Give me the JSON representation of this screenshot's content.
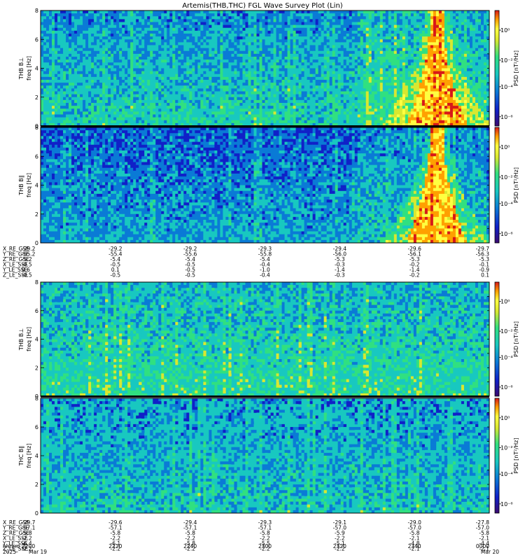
{
  "chart_data": {
    "type": "heatmap",
    "title": "Artemis(THB,THC) FGL Wave Survey Plot (Lin)",
    "panels": [
      {
        "ylabel_line1": "THB B⊥",
        "ylabel_line2": "freq [Hz]",
        "ylim": [
          0,
          8
        ],
        "yticks": [
          "0",
          "2",
          "4",
          "6",
          "8"
        ],
        "colorbar_label": "PSD [nT²/Hz]",
        "colorbar_ticks": [
          "10⁰",
          "10⁻²",
          "10⁻⁴",
          "10⁻⁶"
        ]
      },
      {
        "ylabel_line1": "THB B∥",
        "ylabel_line2": "freq [Hz]",
        "ylim": [
          0,
          8
        ],
        "yticks": [
          "0",
          "2",
          "4",
          "6",
          "8"
        ],
        "colorbar_label": "PSD [nT²/Hz]",
        "colorbar_ticks": [
          "10⁰",
          "10⁻²",
          "10⁻⁴",
          "10⁻⁶"
        ]
      },
      {
        "ylabel_line1": "THB B⊥",
        "ylabel_line2": "freq [Hz]",
        "ylim": [
          0,
          8
        ],
        "yticks": [
          "0",
          "2",
          "4",
          "6",
          "8"
        ],
        "colorbar_label": "PSD [nT²/Hz]",
        "colorbar_ticks": [
          "10⁰",
          "10⁻²",
          "10⁻⁴",
          "10⁻⁶"
        ]
      },
      {
        "ylabel_line1": "THC B∥",
        "ylabel_line2": "freq [Hz]",
        "ylim": [
          0,
          8
        ],
        "yticks": [
          "0",
          "2",
          "4",
          "6",
          "8"
        ],
        "colorbar_label": "PSD [nT²/Hz]",
        "colorbar_ticks": [
          "10⁰",
          "10⁻²",
          "10⁻⁴",
          "10⁻⁶"
        ]
      }
    ],
    "ephemeris_groups": [
      {
        "rows": [
          {
            "label": "X_RE_GSE",
            "values": [
              "-29.2",
              "-29.2",
              "-29.2",
              "-29.3",
              "-29.4",
              "-29.6",
              "-29.7"
            ]
          },
          {
            "label": "Y_RE_GSE",
            "values": [
              "-55.2",
              "-55.4",
              "-55.6",
              "-55.8",
              "-56.0",
              "-56.1",
              "-56.3"
            ]
          },
          {
            "label": "Z_RE_GSE",
            "values": [
              "-5.2",
              "-5.4",
              "-5.4",
              "-5.4",
              "-5.3",
              "-5.3",
              "-5.3"
            ]
          },
          {
            "label": "X_LE_SSE",
            "values": [
              "-0.5",
              "-0.5",
              "-0.5",
              "-0.4",
              "-0.3",
              "-0.2",
              "-0.1"
            ]
          },
          {
            "label": "Y_LE_SSE",
            "values": [
              "0.6",
              "0.1",
              "-0.5",
              "-1.0",
              "-1.4",
              "-1.4",
              "-0.9"
            ]
          },
          {
            "label": "Z_LE_SSE",
            "values": [
              "-0.5",
              "-0.5",
              "-0.5",
              "-0.4",
              "-0.3",
              "-0.2",
              "0.1"
            ]
          }
        ]
      },
      {
        "rows": [
          {
            "label": "X_RE_GSE",
            "values": [
              "-29.7",
              "-29.6",
              "-29.4",
              "-29.3",
              "-29.1",
              "-29.0",
              "-27.8"
            ]
          },
          {
            "label": "Y_RE_GSE",
            "values": [
              "-57.1",
              "-57.1",
              "-57.1",
              "-57.1",
              "-57.0",
              "-57.0",
              "-57.0"
            ]
          },
          {
            "label": "Z_RE_GSE",
            "values": [
              "-5.8",
              "-5.8",
              "-5.8",
              "-5.8",
              "-5.9",
              "-5.8",
              "-5.8"
            ]
          },
          {
            "label": "X_LE_SSE",
            "values": [
              "-2.2",
              "-2.2",
              "-2.2",
              "-2.2",
              "-2.2",
              "-2.1",
              "-2.1"
            ]
          },
          {
            "label": "Y_LE_SSE",
            "values": [
              "-6.4",
              "-6.1",
              "-5.8",
              "-5.5",
              "-5.1",
              "-4.8",
              "-4.4"
            ]
          },
          {
            "label": "Z_LE_SSE",
            "values": [
              "-2.2",
              "-2.2",
              "-2.2",
              "-2.2",
              "-2.2",
              "-2.1",
              "-2.1"
            ]
          }
        ]
      }
    ],
    "time_axis": {
      "label": "hhmm",
      "ticks": [
        "2200",
        "2220",
        "2240",
        "2300",
        "2320",
        "2340",
        "0000"
      ],
      "year": "2025",
      "date_start": "Mar 19",
      "date_end": "Mar 20"
    },
    "colormap": [
      "#3a0a6e",
      "#1020c8",
      "#0a7ad6",
      "#18c8c0",
      "#30e080",
      "#d8e830",
      "#ffff40",
      "#ffa000",
      "#d81818"
    ]
  }
}
